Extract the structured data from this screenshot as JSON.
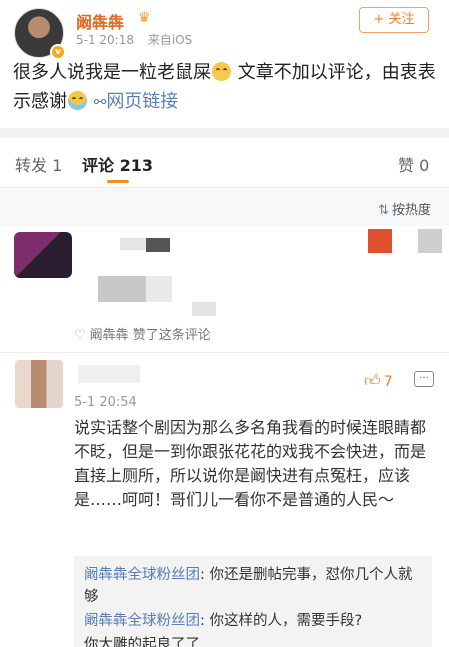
{
  "post": {
    "username": "阚犇犇",
    "time": "5-1 20:18",
    "source": "来自iOS",
    "follow_label": "+ 关注",
    "text_line1_a": "很多人说我是一粒老鼠屎",
    "text_line1_b": "文章不加以评论，由衷表示感谢",
    "link_label": "网页链接"
  },
  "tabs": {
    "repost": "转发 1",
    "comments": "评论 213",
    "likes": "赞 0"
  },
  "sort_label": "按热度",
  "comment1": {
    "liked_by": "阚犇犇  赞了这条评论"
  },
  "comment2": {
    "time": "5-1 20:54",
    "like_count": "7",
    "text": "说实话整个剧因为那么多名角我看的时候连眼睛都不眨，但是一到你跟张花花的戏我不会快进，而是直接上厕所，所以说你是阚快进有点冤枉，应该是……呵呵！哥们儿一看你不是普通的人民～"
  },
  "replies": [
    {
      "name": "阚犇犇全球粉丝团",
      "text": ": 你还是删帖完事，怼你几个人就够"
    },
    {
      "name": "阚犇犇全球粉丝团",
      "text": ": 你这样的人，需要手段?"
    },
    {
      "name": "",
      "text": "你大雕的起良了了"
    }
  ],
  "colors": {
    "accent_orange": "#f48b27",
    "link_blue": "#5a7fb5",
    "username_orange": "#e06b20"
  }
}
